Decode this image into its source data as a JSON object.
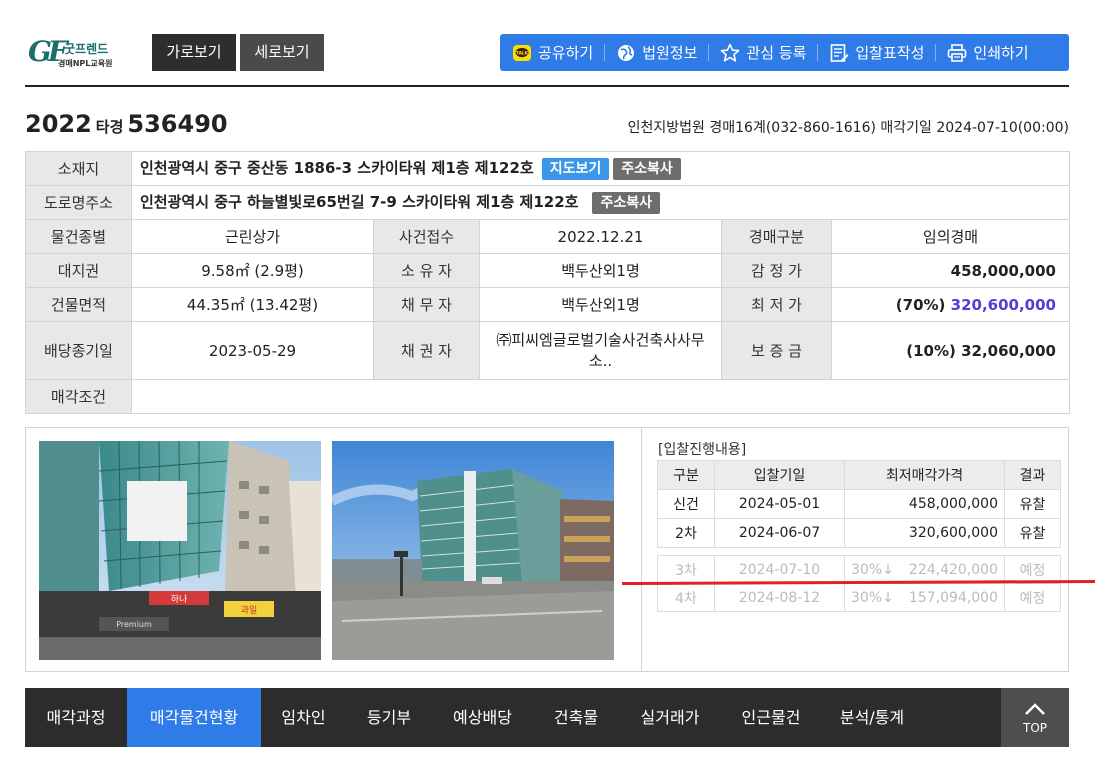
{
  "logo": {
    "mark": "GF",
    "name": "굿프렌드",
    "sub": "경매NPL교육원"
  },
  "view_tabs": [
    "가로보기",
    "세로보기"
  ],
  "toolbar": [
    {
      "label": "공유하기",
      "icon": "kakaotalk-icon"
    },
    {
      "label": "법원정보",
      "icon": "court-globe-icon"
    },
    {
      "label": "관심 등록",
      "icon": "star-icon"
    },
    {
      "label": "입찰표작성",
      "icon": "form-edit-icon"
    },
    {
      "label": "인쇄하기",
      "icon": "printer-icon"
    }
  ],
  "case": {
    "year": "2022",
    "type": "타경",
    "number": "536490",
    "info": "인천지방법원 경매16계(032-860-1616) 매각기일 2024-07-10(00:00)"
  },
  "property": {
    "address_label": "소재지",
    "address": "인천광역시 중구 중산동 1886-3 스카이타워 제1층 제122호",
    "map_button": "지도보기",
    "copy_button": "주소복사",
    "road_label": "도로명주소",
    "road_address": "인천광역시 중구 하늘별빛로65번길 7-9 스카이타워 제1층 제122호",
    "rows": [
      [
        {
          "h": "물건종별",
          "v": "근린상가"
        },
        {
          "h": "사건접수",
          "v": "2022.12.21"
        },
        {
          "h": "경매구분",
          "v": "임의경매"
        }
      ],
      [
        {
          "h": "대지권",
          "v": "9.58㎡ (2.9평)"
        },
        {
          "h": "소 유 자",
          "v": "백두산외1명"
        },
        {
          "h": "감 정 가",
          "v": "458,000,000"
        }
      ],
      [
        {
          "h": "건물면적",
          "v": "44.35㎡ (13.42평)"
        },
        {
          "h": "채 무 자",
          "v": "백두산외1명"
        },
        {
          "h": "최 저 가",
          "pct": "(70%)",
          "v": "320,600,000"
        }
      ],
      [
        {
          "h": "배당종기일",
          "v": "2023-05-29"
        },
        {
          "h": "채 권 자",
          "v": "㈜피씨엠글로벌기술사건축사사무소.."
        },
        {
          "h": "보 증 금",
          "v": "(10%) 32,060,000"
        }
      ]
    ],
    "sale_cond_label": "매각조건",
    "sale_cond": ""
  },
  "bids": {
    "title": "[입찰진행내용]",
    "headers": [
      "구분",
      "입찰기일",
      "최저매각가격",
      "결과"
    ],
    "done": [
      {
        "round": "신건",
        "date": "2024-05-01",
        "price": "458,000,000",
        "result": "유찰"
      },
      {
        "round": "2차",
        "date": "2024-06-07",
        "price": "320,600,000",
        "result": "유찰"
      }
    ],
    "future": [
      {
        "round": "3차",
        "date": "2024-07-10",
        "rate": "30%↓",
        "price": "224,420,000",
        "result": "예정"
      },
      {
        "round": "4차",
        "date": "2024-08-12",
        "rate": "30%↓",
        "price": "157,094,000",
        "result": "예정"
      }
    ]
  },
  "bottom_nav": [
    "매각과정",
    "매각물건현황",
    "임차인",
    "등기부",
    "예상배당",
    "건축물",
    "실거래가",
    "인근물건",
    "분석/통계"
  ],
  "top_button": "TOP",
  "photo_signs": {
    "store_name": "Premium",
    "shop": "하나",
    "sign": "과일"
  }
}
